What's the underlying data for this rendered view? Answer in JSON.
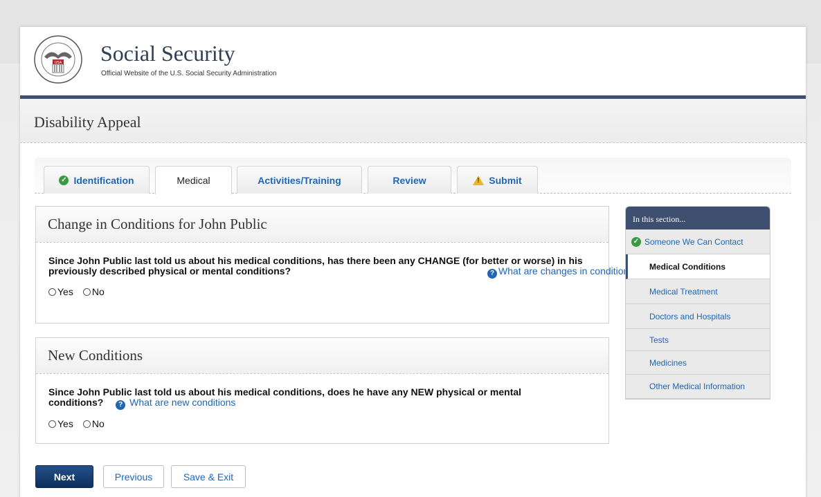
{
  "header": {
    "brand_title": "Social Security",
    "brand_subtitle": "Official Website of the U.S. Social Security Administration",
    "seal_text": "SOCIAL SECURITY ADMINISTRATION USA"
  },
  "app": {
    "title": "Disability Appeal"
  },
  "tabs": [
    {
      "label": "Identification",
      "status": "complete"
    },
    {
      "label": "Medical",
      "status": "active"
    },
    {
      "label": "Activities/Training",
      "status": "none"
    },
    {
      "label": "Review",
      "status": "none"
    },
    {
      "label": "Submit",
      "status": "warning"
    }
  ],
  "sections": [
    {
      "heading": "Change in Conditions for John Public",
      "question": "Since John Public last told us about his medical conditions, has there been any CHANGE (for better or worse) in his previously described physical or mental conditions?",
      "help_text": "What are changes in conditions",
      "options": [
        "Yes",
        "No"
      ]
    },
    {
      "heading": "New Conditions",
      "question": "Since John Public last told us about his medical conditions, does he have any NEW physical or mental conditions?",
      "help_text": "What are new conditions",
      "options": [
        "Yes",
        "No"
      ]
    }
  ],
  "side_nav": {
    "title": "In this section...",
    "items": [
      {
        "label": "Someone We Can Contact",
        "status": "complete"
      },
      {
        "label": "Medical Conditions",
        "status": "current"
      },
      {
        "label": "Medical Treatment",
        "status": "none"
      },
      {
        "label": "Doctors and Hospitals",
        "status": "none"
      },
      {
        "label": "Tests",
        "status": "none"
      },
      {
        "label": "Medicines",
        "status": "none"
      },
      {
        "label": "Other Medical Information",
        "status": "none"
      }
    ]
  },
  "buttons": {
    "next": "Next",
    "previous": "Previous",
    "save_exit": "Save & Exit"
  },
  "colors": {
    "brand_navy": "#3d4e6e",
    "link_blue": "#1f66b5",
    "complete_green": "#3a9a3f",
    "warning_yellow": "#f0b323"
  }
}
